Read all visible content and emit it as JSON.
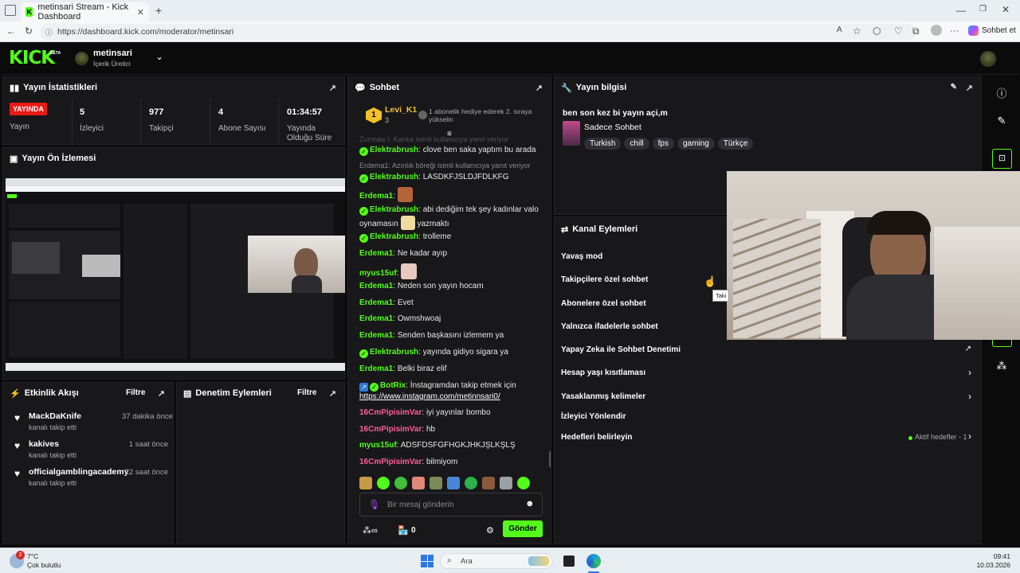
{
  "browser": {
    "tab_title": "metinsari Stream - Kick Dashboard",
    "url": "https://dashboard.kick.com/moderator/metinsari",
    "profile_btn": "Sohbet et"
  },
  "nav": {
    "logo": "KICK",
    "beta": "BETA",
    "channel_name": "metinsari",
    "channel_role": "İçerik Üretici"
  },
  "stats": {
    "title": "Yayın İstatistikleri",
    "live_badge": "YAYINDA",
    "live_label": "Yayın",
    "viewers": "5",
    "viewers_label": "İzleyici",
    "followers": "977",
    "followers_label": "Takipçi",
    "subs": "4",
    "subs_label": "Abone Sayısı",
    "duration": "01:34:57",
    "duration_label": "Yayında Olduğu Süre"
  },
  "preview": {
    "title": "Yayın Ön İzlemesi"
  },
  "events": {
    "title": "Etkinlik Akışı",
    "filter": "Filtre",
    "items": [
      {
        "name": "MackDaKnife",
        "sub": "kanalı takip etti",
        "time": "37 dakika önce"
      },
      {
        "name": "kakives",
        "sub": "kanalı takip etti",
        "time": "1 saat önce"
      },
      {
        "name": "officialgamblingacademy",
        "sub": "kanalı takip etti",
        "time": "22 saat önce"
      }
    ]
  },
  "mod_actions": {
    "title": "Denetim Eylemleri",
    "filter": "Filtre"
  },
  "chat": {
    "title": "Sohbet",
    "pinned_user": "Levi_K1",
    "pinned_level": "3",
    "pinned_text": "1 abonelik hediye ederek 2. sıraya yükselin",
    "sys1": "Zumraw I: Katıka isimli kullanıcıya yanıt veriyor",
    "sys2": "Erdema1: Azınlık böreği isimli kullanıcıya yanıt veriyor",
    "messages": [
      {
        "user": "Elektrabrush",
        "text": "clove ben saka yaptım bu arada"
      },
      {
        "user": "Elektrabrush",
        "text": "LASDKFJSLDJFDLKFG"
      },
      {
        "user": "Erdema1",
        "text": ""
      },
      {
        "user": "Elektrabrush",
        "text": "abi dediğim tek şey kadınlar valo oynamasın",
        "text2": "yazmaktı"
      },
      {
        "user": "Elektrabrush",
        "text": "trolleme"
      },
      {
        "user": "Erdema1",
        "text": "Ne kadar ayıp"
      },
      {
        "user": "myus15uf",
        "text": ""
      },
      {
        "user": "Erdema1",
        "text": "Neden son yayın hocam"
      },
      {
        "user": "Erdema1",
        "text": "Evet"
      },
      {
        "user": "Erdema1",
        "text": "Owmshwoaj"
      },
      {
        "user": "Erdema1",
        "text": "Senden başkasını izlemem ya"
      },
      {
        "user": "Elektrabrush",
        "text": "yayında gidiyo sigara ya"
      },
      {
        "user": "Erdema1",
        "text": "Belki biraz elif"
      },
      {
        "user": "BotRix",
        "text": "İnstagramdan takip etmek için",
        "link": "https://www.instagram.com/metinnsari0/"
      },
      {
        "user": "16CmPipisimVar",
        "text": "iyi yayınlar bombo"
      },
      {
        "user": "16CmPipisimVar",
        "text": "hb"
      },
      {
        "user": "myus15uf",
        "text": "ADSFDSFGFHGKJHKJŞLKŞLŞ"
      },
      {
        "user": "16CmPipisimVar",
        "text": "bilmiyom"
      }
    ],
    "placeholder": "Bir mesaj gönderin",
    "points": "0",
    "send": "Gönder"
  },
  "stream_info": {
    "title": "Yayın bilgisi",
    "stream_title": "ben son kez bi yayın açi,m",
    "category": "Sadece Sohbet",
    "tags": [
      "Turkish",
      "chill",
      "fps",
      "gaming",
      "Türkçe"
    ]
  },
  "channel_actions": {
    "title": "Kanal Eylemleri",
    "items": [
      "Yavaş mod",
      "Takipçilere özel sohbet",
      "Abonelere özel sohbet",
      "Yalnızca ifadelerle sohbet",
      "Yapay Zeka ile Sohbet Denetimi",
      "Hesap yaşı kısıtlaması",
      "Yasaklanmış kelimeler",
      "İzleyici Yönlendir",
      "Hedefleri belirleyin"
    ],
    "goals_status": "Aktif hedefler - 1",
    "tooltip": "Taki"
  },
  "taskbar": {
    "temp": "7°C",
    "weather": "Çok bulutlu",
    "search": "Ara",
    "time": "09:41",
    "date": "10.03.2026",
    "notif": "2"
  }
}
